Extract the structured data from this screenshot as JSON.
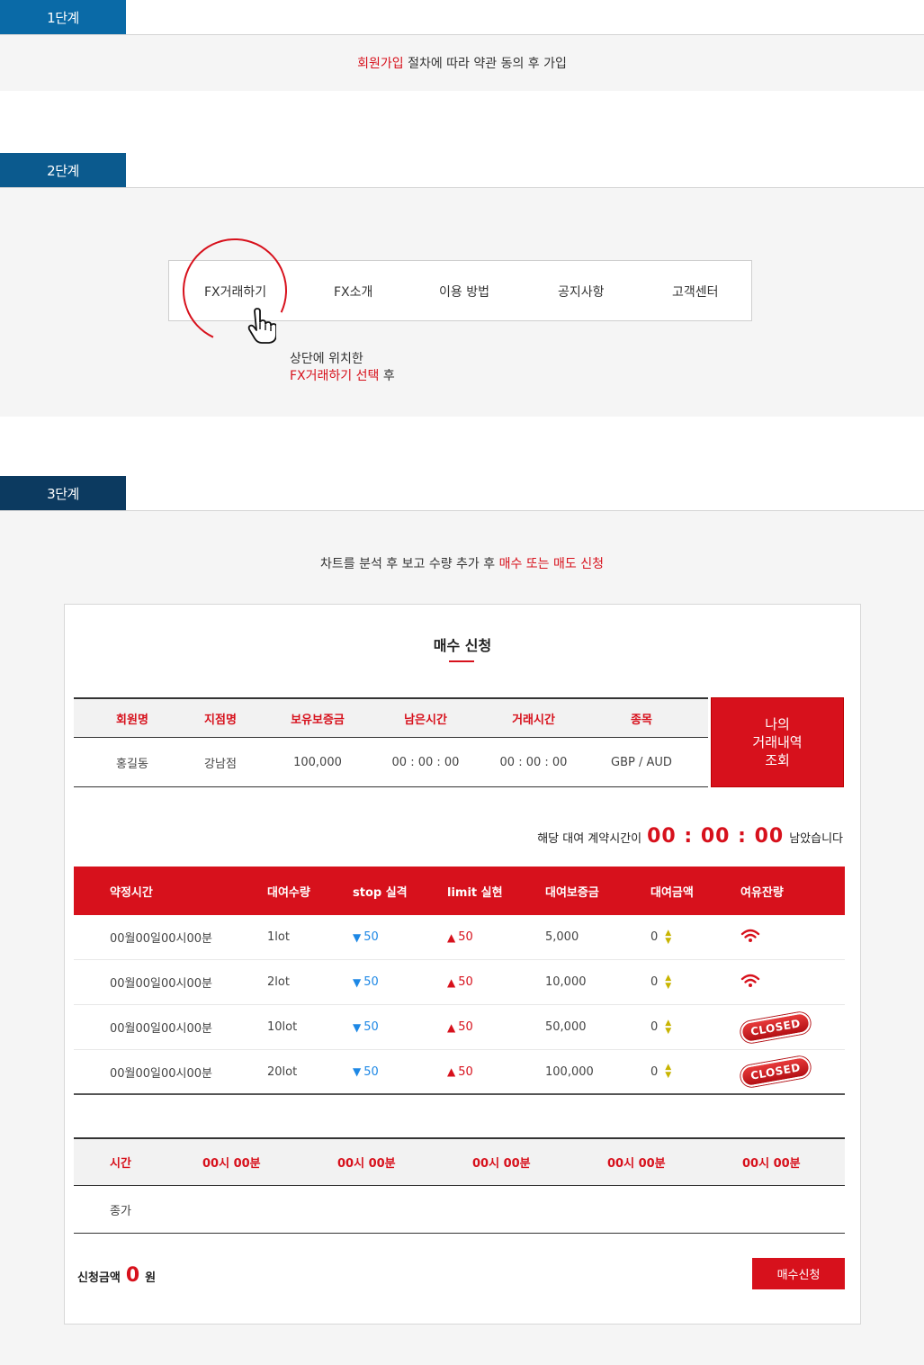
{
  "steps": {
    "step1": {
      "tab": "1단계",
      "highlight": "회원가입",
      "text": " 절차에 따라 약관 동의 후 가입"
    },
    "step2": {
      "tab": "2단계",
      "nav": [
        "FX거래하기",
        "FX소개",
        "이용 방법",
        "공지사항",
        "고객센터"
      ],
      "desc_line1": "상단에 위치한",
      "desc_highlight": "FX거래하기 선택",
      "desc_tail": " 후"
    },
    "step3": {
      "tab": "3단계",
      "intro_prefix": "차트를 분석 후 보고 수량 추가 후 ",
      "intro_highlight": "매수 또는 매도 신청"
    }
  },
  "card": {
    "title": "매수 신청",
    "info": {
      "headers": [
        "회원명",
        "지점명",
        "보유보증금",
        "남은시간",
        "거래시간",
        "종목"
      ],
      "values": [
        "홍길동",
        "강남점",
        "100,000",
        "00 : 00 : 00",
        "00 : 00 : 00",
        "GBP / AUD"
      ]
    },
    "history_button": [
      "나의",
      "거래내역",
      "조회"
    ],
    "remain": {
      "prefix": "해당 대여 계약시간이",
      "time": "00 : 00 : 00",
      "suffix": "남았습니다"
    },
    "trade": {
      "headers": [
        "약정시간",
        "대여수량",
        "stop 실격",
        "limit 실현",
        "대여보증금",
        "대여금액",
        "여유잔량"
      ],
      "rows": [
        {
          "time": "00월00일00시00분",
          "qty": "1lot",
          "stop": "50",
          "limit": "50",
          "deposit": "5,000",
          "amount": "0",
          "status": "signal-icon"
        },
        {
          "time": "00월00일00시00분",
          "qty": "2lot",
          "stop": "50",
          "limit": "50",
          "deposit": "10,000",
          "amount": "0",
          "status": "signal-icon"
        },
        {
          "time": "00월00일00시00분",
          "qty": "10lot",
          "stop": "50",
          "limit": "50",
          "deposit": "50,000",
          "amount": "0",
          "status": "CLOSED"
        },
        {
          "time": "00월00일00시00분",
          "qty": "20lot",
          "stop": "50",
          "limit": "50",
          "deposit": "100,000",
          "amount": "0",
          "status": "CLOSED"
        }
      ]
    },
    "times": {
      "label": "시간",
      "slots": [
        "00시 00분",
        "00시 00분",
        "00시 00분",
        "00시 00분",
        "00시 00분"
      ],
      "close_label": "종가"
    },
    "total": {
      "label": "신청금액",
      "value": "0",
      "unit": "원"
    },
    "buy_button": "매수신청"
  },
  "colors": {
    "accent": "#d7111c",
    "tab1": "#0a6aa7",
    "tab2": "#0b5a8e",
    "tab3": "#0c3a60",
    "panel": "#f5f5f5"
  }
}
